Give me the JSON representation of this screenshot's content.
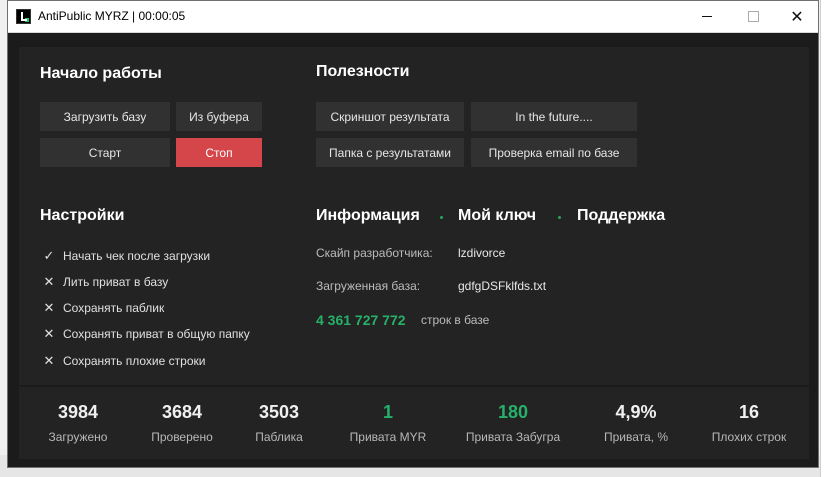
{
  "window": {
    "title": "AntiPublic MYRZ | 00:00:05"
  },
  "start": {
    "heading": "Начало работы",
    "load_db": "Загрузить базу",
    "from_buffer": "Из буфера",
    "start": "Старт",
    "stop": "Стоп"
  },
  "tools": {
    "heading": "Полезности",
    "screenshot": "Скриншот результата",
    "future": "In the future....",
    "results_folder": "Папка с результатами",
    "check_email": "Проверка email по базе"
  },
  "settings": {
    "heading": "Настройки",
    "options": [
      {
        "label": "Начать чек после загрузки",
        "mark": "✓"
      },
      {
        "label": "Лить приват в базу",
        "mark": "✕"
      },
      {
        "label": "Сохранять паблик",
        "mark": "✕"
      },
      {
        "label": "Сохранять приват в общую папку",
        "mark": "✕"
      },
      {
        "label": "Сохранять плохие строки",
        "mark": "✕"
      }
    ]
  },
  "info": {
    "tab_info": "Информация",
    "tab_key": "Мой ключ",
    "tab_support": "Поддержка",
    "skype_label": "Скайп разработчика:",
    "skype_value": "lzdivorce",
    "db_label": "Загруженная база:",
    "db_value": "gdfgDSFklfds.txt",
    "line_count": "4 361 727 772",
    "line_suffix": "строк в базе"
  },
  "stats": [
    {
      "value": "3984",
      "label": "Загружено"
    },
    {
      "value": "3684",
      "label": "Проверено"
    },
    {
      "value": "3503",
      "label": "Паблика"
    },
    {
      "value": "1",
      "label": "Привата MYR"
    },
    {
      "value": "180",
      "label": "Привата Забугра"
    },
    {
      "value": "4,9%",
      "label": "Привата, %"
    },
    {
      "value": "16",
      "label": "Плохих строк"
    }
  ],
  "colors": {
    "accent_green": "#27b06a",
    "stop_red": "#d4464a",
    "background": "#1b1b1b",
    "panel": "#232323",
    "button": "#313131"
  },
  "icons": {
    "app": "app-logo-icon",
    "minimize": "minimize-icon",
    "maximize": "maximize-icon",
    "close": "close-icon"
  }
}
